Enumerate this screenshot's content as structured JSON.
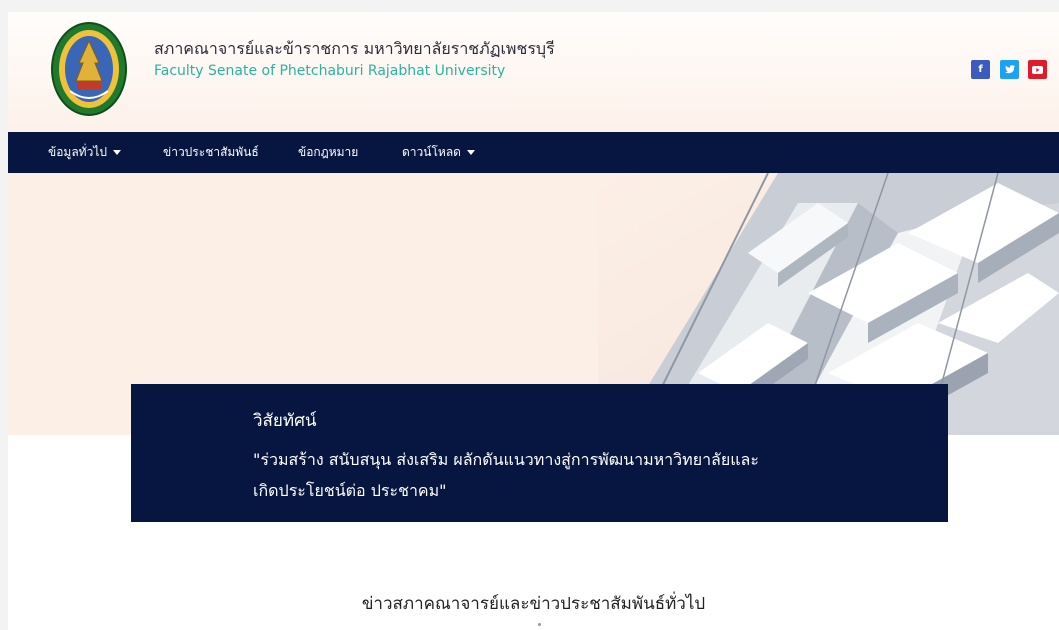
{
  "header": {
    "title_th": "สภาคณาจารย์และข้าราชการ มหาวิทยาลัยราชภัฏเพชรบุรี",
    "title_en": "Faculty Senate of Phetchaburi Rajabhat University",
    "logo_icon": "university-seal-icon",
    "social": [
      {
        "icon": "facebook-icon",
        "glyph": "f",
        "color": "#3b5bbf"
      },
      {
        "icon": "twitter-icon",
        "glyph": "t",
        "color": "#1da1f2"
      },
      {
        "icon": "youtube-icon",
        "glyph": "▶",
        "color": "#e01b2a"
      }
    ]
  },
  "nav": {
    "items": [
      {
        "label": "ข้อมูลทั่วไป",
        "has_dropdown": true
      },
      {
        "label": "ข่าวประชาสัมพันธ์",
        "has_dropdown": false
      },
      {
        "label": "ข้อกฎหมาย",
        "has_dropdown": false
      },
      {
        "label": "ดาวน์โหลด",
        "has_dropdown": true
      }
    ]
  },
  "vision": {
    "heading": "วิสัยทัศน์",
    "line1": "\"ร่วมสร้าง สนับสนุน ส่งเสริม ผลักดันแนวทางสู่การพัฒนามหาวิทยาลัยและ",
    "line2": "เกิดประโยชน์ต่อ ประชาคม\""
  },
  "news": {
    "section_title": "ข่าวสภาคณาจารย์และข่าวประชาสัมพันธ์ทั่วไป"
  },
  "colors": {
    "navy": "#061640",
    "accent_teal": "#2bb3a0",
    "hero_bg": "#fcefe6"
  }
}
